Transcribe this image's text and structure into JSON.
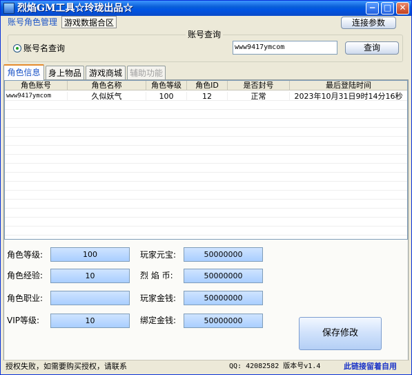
{
  "window": {
    "title": "烈焰GM工具☆玲珑出品☆",
    "controls": {
      "minimize": "−",
      "maximize": "□",
      "close": "✕"
    }
  },
  "top_tabs": [
    "账号角色管理",
    "游戏数据合区"
  ],
  "connect_button": "连接参数",
  "account_query": {
    "group_title": "账号查询",
    "radio_label": "账号名查询",
    "input_value": "www9417ymcom",
    "query_button": "查询"
  },
  "inner_tabs": [
    {
      "label": "角色信息",
      "state": "active"
    },
    {
      "label": "身上物品",
      "state": "normal"
    },
    {
      "label": "游戏商城",
      "state": "normal"
    },
    {
      "label": "辅助功能",
      "state": "disabled"
    }
  ],
  "table": {
    "columns": [
      "角色账号",
      "角色名称",
      "角色等级",
      "角色ID",
      "是否封号",
      "最后登陆时间"
    ],
    "rows": [
      [
        "www9417ymcom",
        "久似妖气",
        "100",
        "12",
        "正常",
        "2023年10月31日9时14分16秒"
      ]
    ]
  },
  "fields": {
    "left": [
      {
        "label": "角色等级:",
        "value": "100"
      },
      {
        "label": "角色经验:",
        "value": "10"
      },
      {
        "label": "角色职业:",
        "value": ""
      },
      {
        "label": "VIP等级:",
        "value": "10"
      }
    ],
    "right": [
      {
        "label": "玩家元宝:",
        "value": "50000000"
      },
      {
        "label": "烈 焰 币:",
        "value": "50000000"
      },
      {
        "label": "玩家金钱:",
        "value": "50000000"
      },
      {
        "label": "绑定金钱:",
        "value": "50000000"
      }
    ]
  },
  "save_button": "保存修改",
  "status": {
    "left_text": "授权失败，如需要购买授权，请联系",
    "qq_version": "QQ: 42082582  版本号v1.4",
    "link_text": "此链接留着自用"
  },
  "colors": {
    "titlebar": "#0054e3",
    "active_tab_text": "#1e56c8",
    "field_bg": "#b7d6ff",
    "status_link": "#1a33c8"
  }
}
